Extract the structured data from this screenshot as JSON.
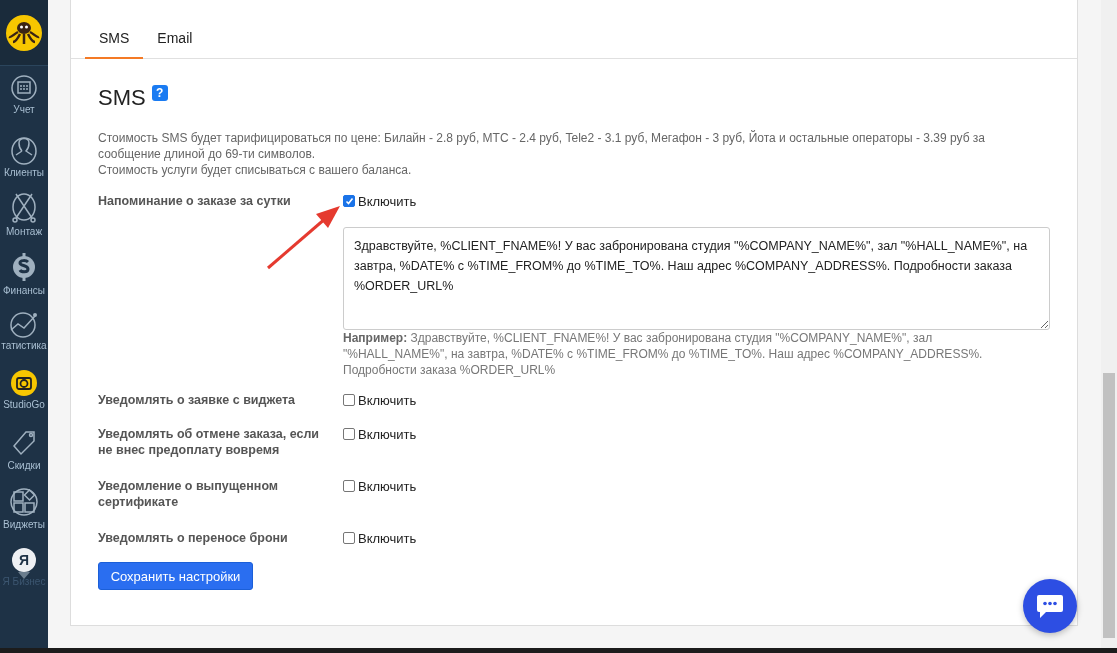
{
  "sidebar": {
    "items": [
      {
        "kind": "calendar",
        "label": "Учет"
      },
      {
        "kind": "person",
        "label": "Клиенты"
      },
      {
        "kind": "scissors",
        "label": "Монтаж"
      },
      {
        "kind": "dollar",
        "label": "Финансы"
      },
      {
        "kind": "chart",
        "label": "татистика"
      },
      {
        "kind": "camera",
        "label": "StudioGo"
      },
      {
        "kind": "tag",
        "label": "Скидки"
      },
      {
        "kind": "widgets",
        "label": "Виджеты"
      },
      {
        "kind": "ya",
        "label": "Я Бизнес",
        "badge": "Я"
      }
    ]
  },
  "tabs": [
    {
      "label": "SMS",
      "selected": true
    },
    {
      "label": "Email",
      "selected": false
    }
  ],
  "section": {
    "title": "SMS",
    "help": "?",
    "notes": [
      "Стоимость SMS будет тарифицироваться по цене: Билайн - 2.8 руб, МТС - 2.4 руб, Tele2 - 3.1 руб, Мегафон - 3 руб, Йота и остальные операторы - 3.39 руб за сообщение длиной до 69-ти символов.",
      "Стоимость услуги будет списываться с вашего баланса."
    ]
  },
  "settings": [
    {
      "label": "Напоминание о заказе за сутки",
      "checkbox": "Включить",
      "checked": true,
      "template": "Здравствуйте, %CLIENT_FNAME%! У вас забронирована студия \"%COMPANY_NAME%\", зал \"%HALL_NAME%\", на завтра, %DATE% с %TIME_FROM% до %TIME_TO%. Наш адрес %COMPANY_ADDRESS%. Подробности заказа %ORDER_URL%",
      "example": "**Например:** Здравствуйте, %CLIENT_FNAME%! У вас забронирована студия \"%COMPANY_NAME%\", зал \"%HALL_NAME%\", на завтра, %DATE% с %TIME_FROM% до %TIME_TO%. Наш адрес %COMPANY_ADDRESS%. Подробности заказа %ORDER_URL%"
    },
    {
      "label": "Уведомлять о заявке с виджета",
      "checkbox": "Включить",
      "checked": false
    },
    {
      "label": "Уведомлять об отмене заказа, если не внес предоплату вовремя",
      "checkbox": "Включить",
      "checked": false
    },
    {
      "label": "Уведомление о выпущенном сертификате",
      "checkbox": "Включить",
      "checked": false
    },
    {
      "label": "Уведомлять о переносе брони",
      "checkbox": "Включить",
      "checked": false
    }
  ],
  "save_button": "Сохранить настройки"
}
